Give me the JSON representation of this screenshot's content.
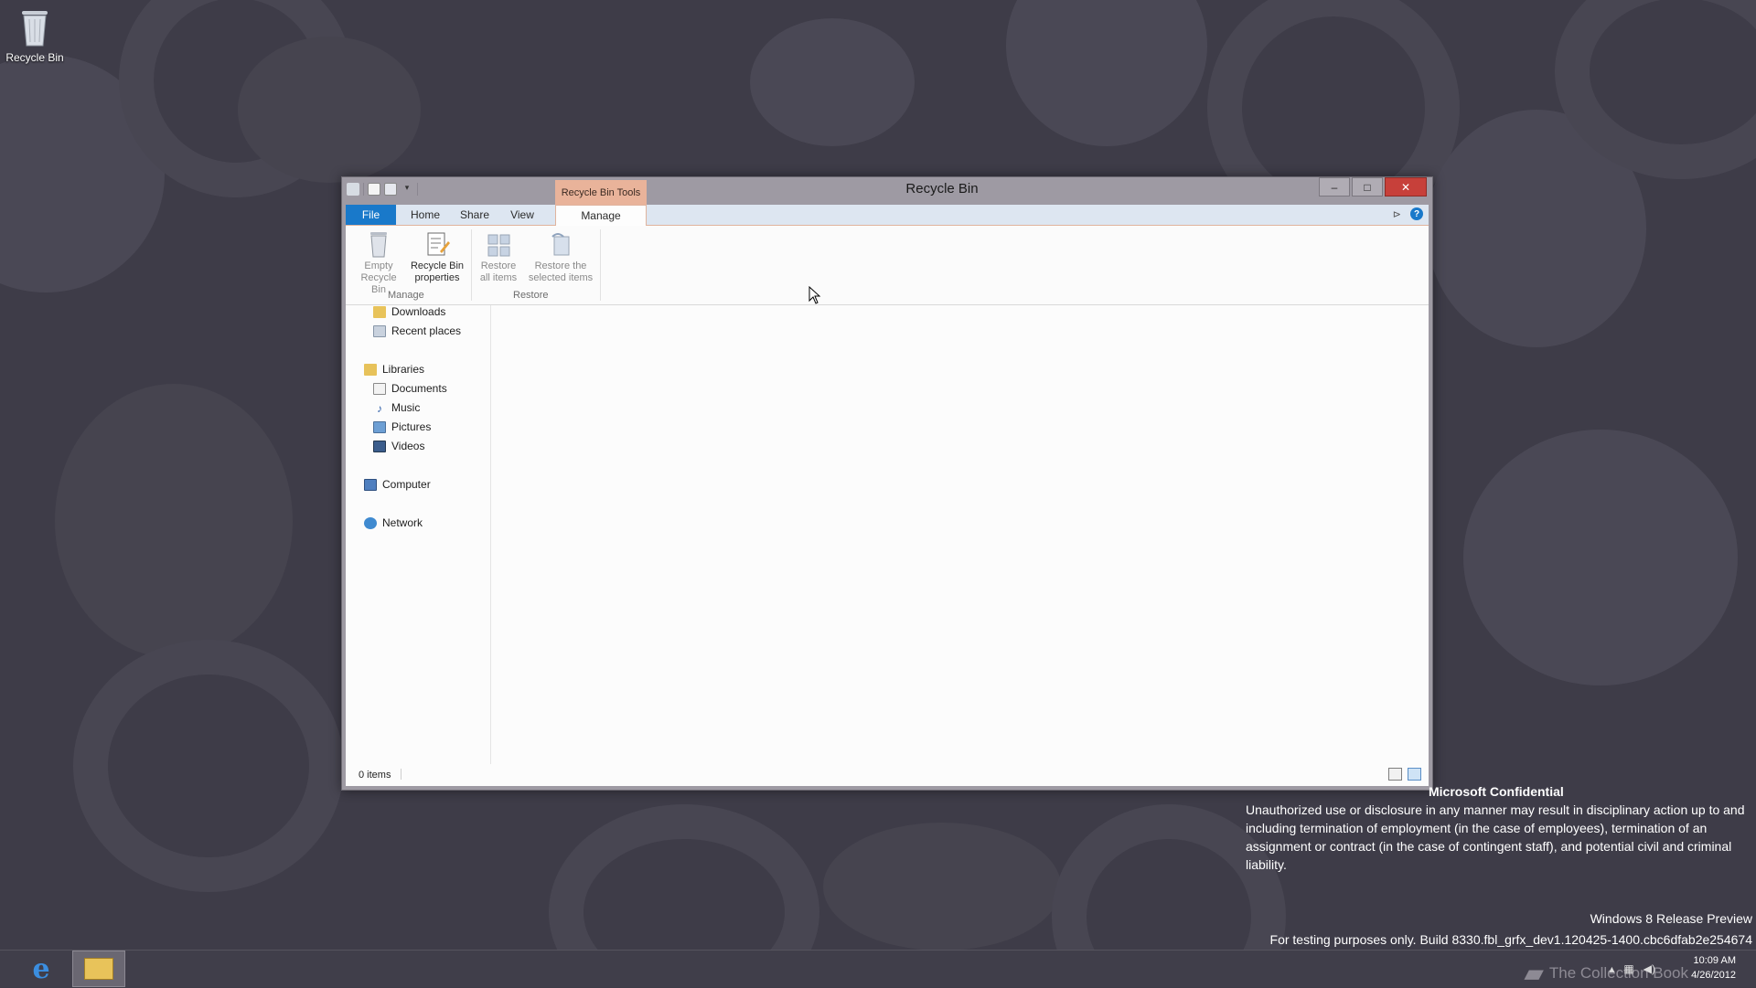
{
  "desktop": {
    "recycle_bin_label": "Recycle Bin"
  },
  "window": {
    "title": "Recycle Bin",
    "context_tab_group": "Recycle Bin Tools",
    "buttons": {
      "minimize": "–",
      "maximize": "□",
      "close": "✕"
    }
  },
  "ribbon": {
    "tabs": [
      "File",
      "Home",
      "Share",
      "View",
      "Manage"
    ],
    "help": "?",
    "groups": {
      "manage": {
        "label": "Manage",
        "empty_line1": "Empty",
        "empty_line2": "Recycle Bin",
        "props_line1": "Recycle Bin",
        "props_line2": "properties"
      },
      "restore": {
        "label": "Restore",
        "all_line1": "Restore",
        "all_line2": "all items",
        "sel_line1": "Restore the",
        "sel_line2": "selected items"
      }
    }
  },
  "nav": {
    "downloads": "Downloads",
    "recent": "Recent places",
    "libraries": "Libraries",
    "documents": "Documents",
    "music": "Music",
    "pictures": "Pictures",
    "videos": "Videos",
    "computer": "Computer",
    "network": "Network"
  },
  "status": {
    "items": "0 items"
  },
  "watermark": {
    "heading": "Microsoft Confidential",
    "body": "Unauthorized use or disclosure in any manner may result in disciplinary action up to and including termination of employment (in the case of employees), termination of an assignment or contract (in the case of contingent staff), and potential civil and criminal liability.",
    "edition": "Windows 8 Release Preview",
    "build": "For testing purposes only. Build 8330.fbl_grfx_dev1.120425-1400.cbc6dfab2e254674"
  },
  "taskbar": {
    "time": "10:09 AM",
    "date": "4/26/2012",
    "overlay_logo_text": "The Collection Book"
  },
  "colors": {
    "desktop": "#3e3c48",
    "file_tab": "#1979ca",
    "context_tab": "#e9b39a",
    "close_button": "#c7403a"
  }
}
